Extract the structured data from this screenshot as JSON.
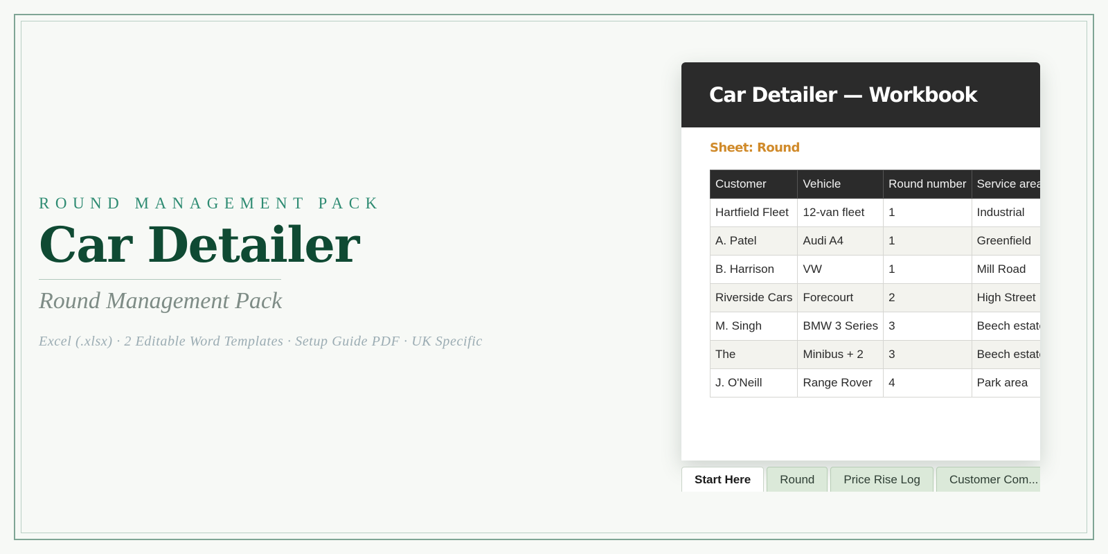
{
  "branding": {
    "eyebrow": "ROUND MANAGEMENT PACK",
    "title": "Car Detailer",
    "subtitle": "Round Management Pack",
    "meta": "Excel (.xlsx) · 2 Editable Word Templates · Setup Guide PDF · UK Specific"
  },
  "workbook": {
    "title": "Car Detailer — Workbook",
    "sheet_label": "Sheet: Round",
    "table": {
      "headers": [
        "Customer",
        "Vehicle",
        "Round number",
        "Service area"
      ],
      "rows": [
        [
          "Hartfield Fleet",
          "12-van fleet",
          "1",
          "Industrial"
        ],
        [
          "A. Patel",
          "Audi A4",
          "1",
          "Greenfield"
        ],
        [
          "B. Harrison",
          "VW",
          "1",
          "Mill Road"
        ],
        [
          "Riverside Cars",
          "Forecourt",
          "2",
          "High Street"
        ],
        [
          "M. Singh",
          "BMW 3 Series",
          "3",
          "Beech estate"
        ],
        [
          "The",
          "Minibus + 2",
          "3",
          "Beech estate"
        ],
        [
          "J. O'Neill",
          "Range Rover",
          "4",
          "Park area"
        ]
      ]
    },
    "tabs": [
      {
        "label": "Start Here",
        "active": true
      },
      {
        "label": "Round",
        "active": false
      },
      {
        "label": "Price Rise Log",
        "active": false
      },
      {
        "label": "Customer Com...",
        "active": false
      }
    ]
  },
  "colors": {
    "accent": "#2e8b72",
    "title": "#0f4a33",
    "header_bg": "#2b2b2b",
    "sheet_label": "#d08a2a",
    "tab_bg": "#dbe9d9"
  }
}
